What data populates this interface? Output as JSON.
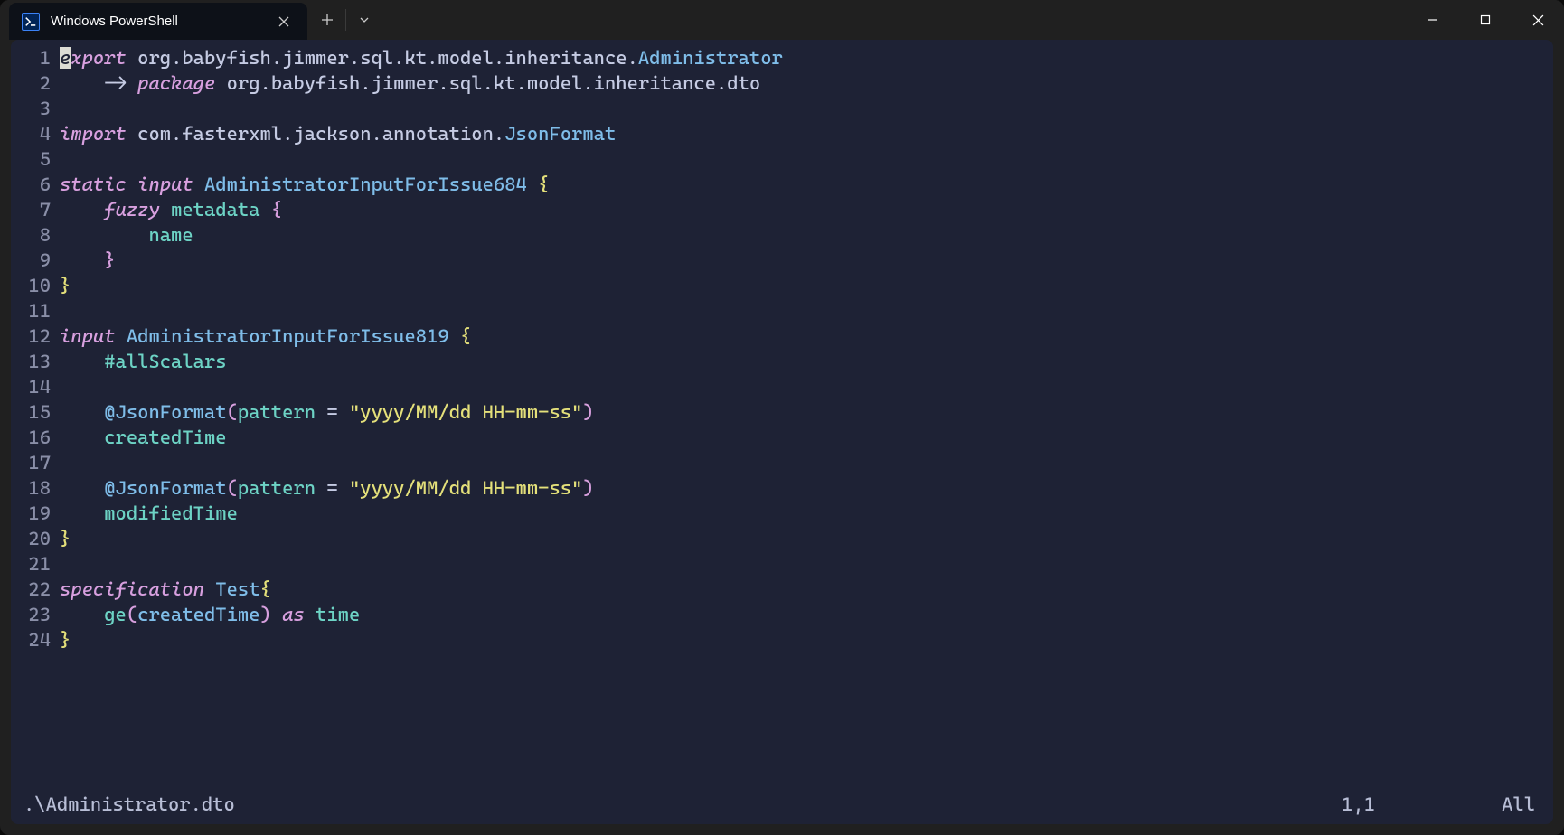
{
  "tab": {
    "title": "Windows PowerShell"
  },
  "code": {
    "lines": [
      {
        "n": 1,
        "tokens": [
          {
            "t": "e",
            "c": "cursor-bg"
          },
          {
            "t": "xport",
            "c": "kw-it"
          },
          {
            "t": " ",
            "c": ""
          },
          {
            "t": "org.babyfish.jimmer.sql.kt.model.inheritance.",
            "c": "pkg"
          },
          {
            "t": "Administrator",
            "c": "type"
          }
        ]
      },
      {
        "n": 2,
        "tokens": [
          {
            "t": "    ",
            "c": ""
          },
          {
            "t": "->",
            "c": "arrow"
          },
          {
            "t": " ",
            "c": ""
          },
          {
            "t": "package",
            "c": "kw-it"
          },
          {
            "t": " ",
            "c": ""
          },
          {
            "t": "org.babyfish.jimmer.sql.kt.model.inheritance.dto",
            "c": "pkg"
          }
        ]
      },
      {
        "n": 3,
        "tokens": []
      },
      {
        "n": 4,
        "tokens": [
          {
            "t": "import",
            "c": "kw-it"
          },
          {
            "t": " ",
            "c": ""
          },
          {
            "t": "com.fasterxml.jackson.annotation.",
            "c": "pkg"
          },
          {
            "t": "JsonFormat",
            "c": "type"
          }
        ]
      },
      {
        "n": 5,
        "tokens": []
      },
      {
        "n": 6,
        "tokens": [
          {
            "t": "static",
            "c": "kw-it"
          },
          {
            "t": " ",
            "c": ""
          },
          {
            "t": "input",
            "c": "kw-it"
          },
          {
            "t": " ",
            "c": ""
          },
          {
            "t": "AdministratorInputForIssue684",
            "c": "type"
          },
          {
            "t": " ",
            "c": ""
          },
          {
            "t": "{",
            "c": "brace"
          }
        ]
      },
      {
        "n": 7,
        "tokens": [
          {
            "t": "    ",
            "c": ""
          },
          {
            "t": "fuzzy",
            "c": "kw-it"
          },
          {
            "t": " ",
            "c": ""
          },
          {
            "t": "metadata",
            "c": "ident"
          },
          {
            "t": " ",
            "c": ""
          },
          {
            "t": "{",
            "c": "paren-p"
          }
        ]
      },
      {
        "n": 8,
        "tokens": [
          {
            "t": "        ",
            "c": ""
          },
          {
            "t": "name",
            "c": "ident"
          }
        ]
      },
      {
        "n": 9,
        "tokens": [
          {
            "t": "    ",
            "c": ""
          },
          {
            "t": "}",
            "c": "paren-p"
          }
        ]
      },
      {
        "n": 10,
        "tokens": [
          {
            "t": "}",
            "c": "brace"
          }
        ]
      },
      {
        "n": 11,
        "tokens": []
      },
      {
        "n": 12,
        "tokens": [
          {
            "t": "input",
            "c": "kw-it"
          },
          {
            "t": " ",
            "c": ""
          },
          {
            "t": "AdministratorInputForIssue819",
            "c": "type"
          },
          {
            "t": " ",
            "c": ""
          },
          {
            "t": "{",
            "c": "brace"
          }
        ]
      },
      {
        "n": 13,
        "tokens": [
          {
            "t": "    ",
            "c": ""
          },
          {
            "t": "#allScalars",
            "c": "ident"
          }
        ]
      },
      {
        "n": 14,
        "tokens": []
      },
      {
        "n": 15,
        "tokens": [
          {
            "t": "    ",
            "c": ""
          },
          {
            "t": "@JsonFormat",
            "c": "type"
          },
          {
            "t": "(",
            "c": "paren-p"
          },
          {
            "t": "pattern",
            "c": "ident"
          },
          {
            "t": " = ",
            "c": "op"
          },
          {
            "t": "\"yyyy/MM/dd HH-mm-ss\"",
            "c": "str"
          },
          {
            "t": ")",
            "c": "paren-p"
          }
        ]
      },
      {
        "n": 16,
        "tokens": [
          {
            "t": "    ",
            "c": ""
          },
          {
            "t": "createdTime",
            "c": "ident"
          }
        ]
      },
      {
        "n": 17,
        "tokens": []
      },
      {
        "n": 18,
        "tokens": [
          {
            "t": "    ",
            "c": ""
          },
          {
            "t": "@JsonFormat",
            "c": "type"
          },
          {
            "t": "(",
            "c": "paren-p"
          },
          {
            "t": "pattern",
            "c": "ident"
          },
          {
            "t": " = ",
            "c": "op"
          },
          {
            "t": "\"yyyy/MM/dd HH-mm-ss\"",
            "c": "str"
          },
          {
            "t": ")",
            "c": "paren-p"
          }
        ]
      },
      {
        "n": 19,
        "tokens": [
          {
            "t": "    ",
            "c": ""
          },
          {
            "t": "modifiedTime",
            "c": "ident"
          }
        ]
      },
      {
        "n": 20,
        "tokens": [
          {
            "t": "}",
            "c": "brace"
          }
        ]
      },
      {
        "n": 21,
        "tokens": []
      },
      {
        "n": 22,
        "tokens": [
          {
            "t": "specification",
            "c": "kw-it"
          },
          {
            "t": " ",
            "c": ""
          },
          {
            "t": "Test",
            "c": "type"
          },
          {
            "t": "{",
            "c": "brace"
          }
        ]
      },
      {
        "n": 23,
        "tokens": [
          {
            "t": "    ",
            "c": ""
          },
          {
            "t": "ge",
            "c": "ident"
          },
          {
            "t": "(",
            "c": "paren-p"
          },
          {
            "t": "createdTime",
            "c": "type"
          },
          {
            "t": ")",
            "c": "paren-p"
          },
          {
            "t": " ",
            "c": ""
          },
          {
            "t": "as",
            "c": "kw-it"
          },
          {
            "t": " ",
            "c": ""
          },
          {
            "t": "time",
            "c": "ident"
          }
        ]
      },
      {
        "n": 24,
        "tokens": [
          {
            "t": "}",
            "c": "brace"
          }
        ]
      }
    ]
  },
  "status": {
    "file": ".\\Administrator.dto",
    "pos": "1,1",
    "scroll": "All"
  }
}
